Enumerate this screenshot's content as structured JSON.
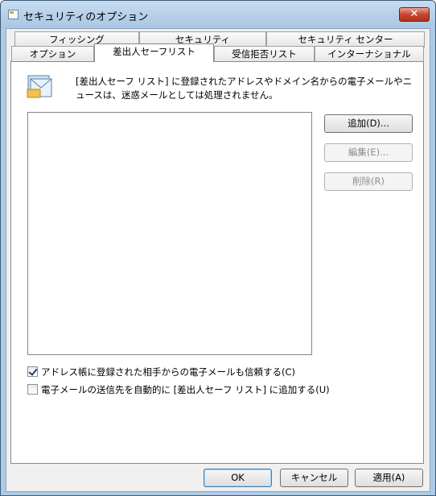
{
  "window": {
    "title": "セキュリティのオプション",
    "close_glyph": "✕"
  },
  "tabs": {
    "row_back": [
      {
        "label": "フィッシング"
      },
      {
        "label": "セキュリティ"
      },
      {
        "label": "セキュリティ センター"
      }
    ],
    "row_front": [
      {
        "label": "オプション"
      },
      {
        "label": "差出人セーフリスト",
        "active": true
      },
      {
        "label": "受信拒否リスト"
      },
      {
        "label": "インターナショナル"
      }
    ]
  },
  "panel": {
    "description": "[差出人セーフ リスト] に登録されたアドレスやドメイン名からの電子メールやニュースは、迷惑メールとしては処理されません。",
    "buttons": {
      "add": "追加(D)...",
      "edit": "編集(E)...",
      "delete": "削除(R)"
    },
    "checkboxes": [
      {
        "label": "アドレス帳に登録された相手からの電子メールも信頼する(C)",
        "checked": true
      },
      {
        "label": "電子メールの送信先を自動的に [差出人セーフ リスト] に追加する(U)",
        "checked": false
      }
    ]
  },
  "footer": {
    "ok": "OK",
    "cancel": "キャンセル",
    "apply": "適用(A)"
  }
}
